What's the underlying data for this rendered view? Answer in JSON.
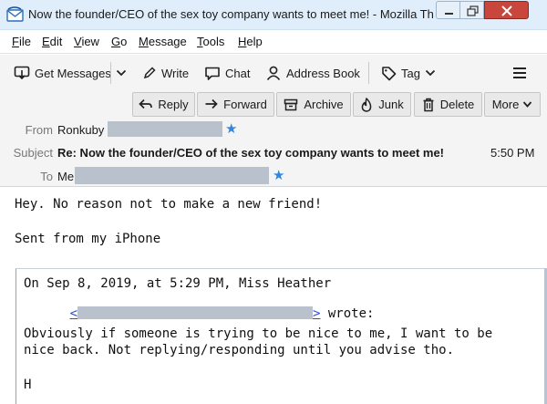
{
  "window": {
    "title": "Now the founder/CEO of the sex toy company wants to meet me! - Mozilla Thunderbird",
    "icon": "thunderbird-logo"
  },
  "menubar": {
    "items": [
      {
        "label": "File",
        "underline": "F"
      },
      {
        "label": "Edit",
        "underline": "E"
      },
      {
        "label": "View",
        "underline": "V"
      },
      {
        "label": "Go",
        "underline": "G"
      },
      {
        "label": "Message",
        "underline": "M"
      },
      {
        "label": "Tools",
        "underline": "T"
      },
      {
        "label": "Help",
        "underline": "H"
      }
    ]
  },
  "toolbar": {
    "get_messages": "Get Messages",
    "write": "Write",
    "chat": "Chat",
    "address_book": "Address Book",
    "tag": "Tag",
    "icons": [
      "get-messages-icon",
      "pencil-icon",
      "chat-icon",
      "address-book-icon",
      "tag-icon",
      "hamburger-menu-icon"
    ]
  },
  "header_buttons": {
    "reply": "Reply",
    "forward": "Forward",
    "archive": "Archive",
    "junk": "Junk",
    "delete": "Delete",
    "more": "More"
  },
  "message": {
    "from_label": "From",
    "from_name": "Ronkuby",
    "subject_label": "Subject",
    "subject": "Re: Now the founder/CEO of the sex toy company wants to meet me!",
    "time": "5:50 PM",
    "to_label": "To",
    "to_name": "Me"
  },
  "body": {
    "line1": "Hey. No reason not to make a new friend!",
    "line2": "Sent from my iPhone",
    "quote_header": "On Sep 8, 2019, at 5:29 PM, Miss Heather",
    "quote_link_open": "<",
    "quote_link_close": ">",
    "quote_wrote": " wrote:",
    "quote_line1": "Obviously if someone is trying to be nice to me, I want to be",
    "quote_line2": "nice back. Not replying/responding until you advise tho.",
    "quote_sig": "H"
  },
  "colors": {
    "titlebar": "#dfeefa",
    "close_button": "#c9463d",
    "star": "#2f87e0",
    "redaction": "#b8c1cc",
    "link": "#2a4cd6"
  }
}
